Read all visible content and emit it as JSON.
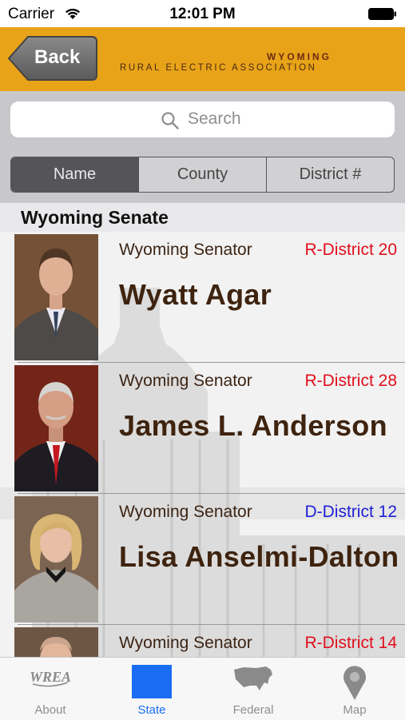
{
  "status_bar": {
    "carrier": "Carrier",
    "time": "12:01 PM"
  },
  "header": {
    "back_label": "Back",
    "logo_line1": "WYOMING",
    "logo_line2": "RURAL ELECTRIC ASSOCIATION"
  },
  "search": {
    "placeholder": "Search"
  },
  "segments": [
    "Name",
    "County",
    "District #"
  ],
  "active_segment": "Name",
  "section": {
    "title": "Wyoming Senate"
  },
  "legislators": [
    {
      "role": "Wyoming Senator",
      "district": "R-District 20",
      "party": "R",
      "name": "Wyatt Agar"
    },
    {
      "role": "Wyoming Senator",
      "district": "R-District 28",
      "party": "R",
      "name": "James L. Anderson"
    },
    {
      "role": "Wyoming Senator",
      "district": "D-District 12",
      "party": "D",
      "name": "Lisa Anselmi-Dalton"
    },
    {
      "role": "Wyoming Senator",
      "district": "R-District 14",
      "party": "R",
      "name": ""
    }
  ],
  "tabs": [
    {
      "label": "About",
      "icon": "wrea-logo-icon",
      "icon_text": "WREA"
    },
    {
      "label": "State",
      "icon": "wyoming-state-icon",
      "active": true
    },
    {
      "label": "Federal",
      "icon": "usa-map-icon"
    },
    {
      "label": "Map",
      "icon": "map-pin-icon"
    }
  ],
  "colors": {
    "header_bg": "#e8a319",
    "republican": "#e0101c",
    "democrat": "#2020d8",
    "active_tab": "#1a6df2",
    "name_text": "#3e230f"
  }
}
